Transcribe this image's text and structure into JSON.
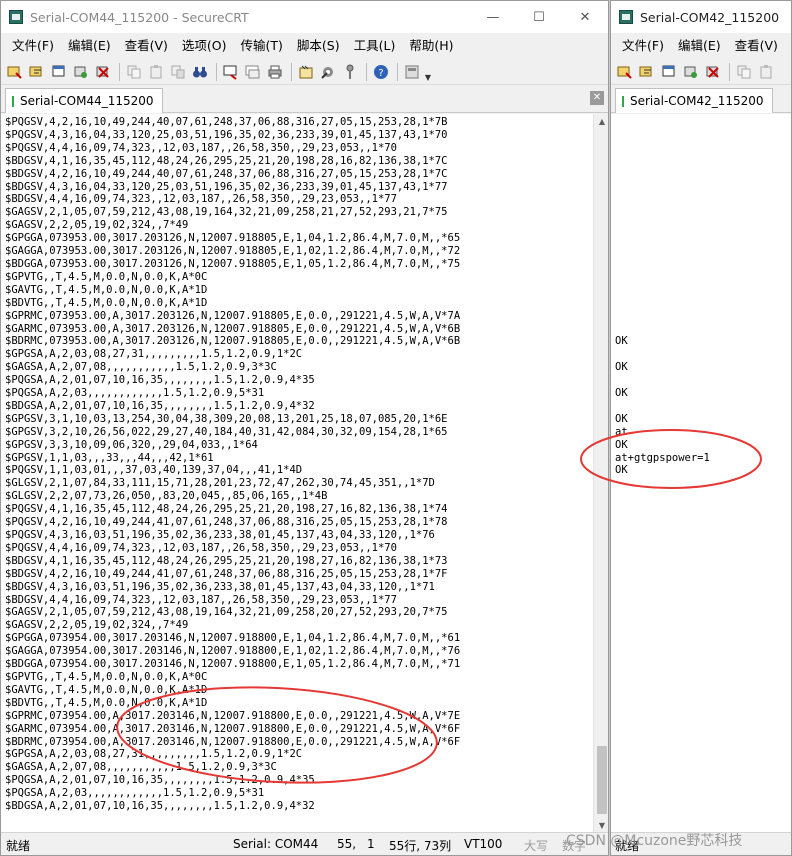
{
  "left": {
    "title": "Serial-COM44_115200 - SecureCRT",
    "tab_label": "Serial-COM44_115200",
    "menu": [
      "文件(F)",
      "编辑(E)",
      "查看(V)",
      "选项(O)",
      "传输(T)",
      "脚本(S)",
      "工具(L)",
      "帮助(H)"
    ],
    "terminal_lines": [
      "$PQGSV,4,2,16,10,49,244,40,07,61,248,37,06,88,316,27,05,15,253,28,1*7B",
      "$PQGSV,4,3,16,04,33,120,25,03,51,196,35,02,36,233,39,01,45,137,43,1*70",
      "$PQGSV,4,4,16,09,74,323,,12,03,187,,26,58,350,,29,23,053,,1*70",
      "$BDGSV,4,1,16,35,45,112,48,24,26,295,25,21,20,198,28,16,82,136,38,1*7C",
      "$BDGSV,4,2,16,10,49,244,40,07,61,248,37,06,88,316,27,05,15,253,28,1*7C",
      "$BDGSV,4,3,16,04,33,120,25,03,51,196,35,02,36,233,39,01,45,137,43,1*77",
      "$BDGSV,4,4,16,09,74,323,,12,03,187,,26,58,350,,29,23,053,,1*77",
      "$GAGSV,2,1,05,07,59,212,43,08,19,164,32,21,09,258,21,27,52,293,21,7*75",
      "$GAGSV,2,2,05,19,02,324,,7*49",
      "$GPGGA,073953.00,3017.203126,N,12007.918805,E,1,04,1.2,86.4,M,7.0,M,,*65",
      "$GAGGA,073953.00,3017.203126,N,12007.918805,E,1,02,1.2,86.4,M,7.0,M,,*72",
      "$BDGGA,073953.00,3017.203126,N,12007.918805,E,1,05,1.2,86.4,M,7.0,M,,*75",
      "$GPVTG,,T,4.5,M,0.0,N,0.0,K,A*0C",
      "$GAVTG,,T,4.5,M,0.0,N,0.0,K,A*1D",
      "$BDVTG,,T,4.5,M,0.0,N,0.0,K,A*1D",
      "$GPRMC,073953.00,A,3017.203126,N,12007.918805,E,0.0,,291221,4.5,W,A,V*7A",
      "$GARMC,073953.00,A,3017.203126,N,12007.918805,E,0.0,,291221,4.5,W,A,V*6B",
      "$BDRMC,073953.00,A,3017.203126,N,12007.918805,E,0.0,,291221,4.5,W,A,V*6B",
      "$GPGSA,A,2,03,08,27,31,,,,,,,,,1.5,1.2,0.9,1*2C",
      "$GAGSA,A,2,07,08,,,,,,,,,,,1.5,1.2,0.9,3*3C",
      "$PQGSA,A,2,01,07,10,16,35,,,,,,,,1.5,1.2,0.9,4*35",
      "$PQGSA,A,2,03,,,,,,,,,,,,1.5,1.2,0.9,5*31",
      "$BDGSA,A,2,01,07,10,16,35,,,,,,,,1.5,1.2,0.9,4*32",
      "$GPGSV,3,1,10,03,13,254,30,04,38,309,20,08,13,201,25,18,07,085,20,1*6E",
      "$GPGSV,3,2,10,26,56,022,29,27,40,184,40,31,42,084,30,32,09,154,28,1*65",
      "$GPGSV,3,3,10,09,06,320,,29,04,033,,1*64",
      "$GPGSV,1,1,03,,,33,,,44,,,42,1*61",
      "$PQGSV,1,1,03,01,,,37,03,40,139,37,04,,,41,1*4D",
      "$GLGSV,2,1,07,84,33,111,15,71,28,201,23,72,47,262,30,74,45,351,,1*7D",
      "$GLGSV,2,2,07,73,26,050,,83,20,045,,85,06,165,,1*4B",
      "$PQGSV,4,1,16,35,45,112,48,24,26,295,25,21,20,198,27,16,82,136,38,1*74",
      "$PQGSV,4,2,16,10,49,244,41,07,61,248,37,06,88,316,25,05,15,253,28,1*78",
      "$PQGSV,4,3,16,03,51,196,35,02,36,233,38,01,45,137,43,04,33,120,,1*76",
      "$PQGSV,4,4,16,09,74,323,,12,03,187,,26,58,350,,29,23,053,,1*70",
      "$BDGSV,4,1,16,35,45,112,48,24,26,295,25,21,20,198,27,16,82,136,38,1*73",
      "$BDGSV,4,2,16,10,49,244,41,07,61,248,37,06,88,316,25,05,15,253,28,1*7F",
      "$BDGSV,4,3,16,03,51,196,35,02,36,233,38,01,45,137,43,04,33,120,,1*71",
      "$BDGSV,4,4,16,09,74,323,,12,03,187,,26,58,350,,29,23,053,,1*77",
      "$GAGSV,2,1,05,07,59,212,43,08,19,164,32,21,09,258,20,27,52,293,20,7*75",
      "$GAGSV,2,2,05,19,02,324,,7*49",
      "$GPGGA,073954.00,3017.203146,N,12007.918800,E,1,04,1.2,86.4,M,7.0,M,,*61",
      "$GAGGA,073954.00,3017.203146,N,12007.918800,E,1,02,1.2,86.4,M,7.0,M,,*76",
      "$BDGGA,073954.00,3017.203146,N,12007.918800,E,1,05,1.2,86.4,M,7.0,M,,*71",
      "$GPVTG,,T,4.5,M,0.0,N,0.0,K,A*0C",
      "$GAVTG,,T,4.5,M,0.0,N,0.0,K,A*1D",
      "$BDVTG,,T,4.5,M,0.0,N,0.0,K,A*1D",
      "$GPRMC,073954.00,A,3017.203146,N,12007.918800,E,0.0,,291221,4.5,W,A,V*7E",
      "$GARMC,073954.00,A,3017.203146,N,12007.918800,E,0.0,,291221,4.5,W,A,V*6F",
      "$BDRMC,073954.00,A,3017.203146,N,12007.918800,E,0.0,,291221,4.5,W,A,V*6F",
      "$GPGSA,A,2,03,08,27,31,,,,,,,,,1.5,1.2,0.9,1*2C",
      "$GAGSA,A,2,07,08,,,,,,,,,,,1.5,1.2,0.9,3*3C",
      "$PQGSA,A,2,01,07,10,16,35,,,,,,,,1.5,1.2,0.9,4*35",
      "$PQGSA,A,2,03,,,,,,,,,,,,1.5,1.2,0.9,5*31",
      "$BDGSA,A,2,01,07,10,16,35,,,,,,,,1.5,1.2,0.9,4*32"
    ],
    "status": {
      "ready": "就绪",
      "connection": "Serial: COM44",
      "row": "55,",
      "col": "1",
      "cursor": "55行, 73列",
      "emulation": "VT100",
      "caps": "大写",
      "num": "数字"
    }
  },
  "right": {
    "title": "Serial-COM42_115200",
    "tab_label": "Serial-COM42_115200",
    "menu": [
      "文件(F)",
      "编辑(E)",
      "查看(V)"
    ],
    "terminal_lines": [
      "",
      "",
      "",
      "",
      "",
      "",
      "",
      "",
      "",
      "",
      "",
      "",
      "",
      "",
      "",
      "",
      "",
      "OK",
      "",
      "OK",
      "",
      "OK",
      "",
      "OK",
      "at",
      "OK",
      "at+gtgpspower=1",
      "OK"
    ],
    "status": {
      "ready": "就绪"
    }
  },
  "watermark": "CSDN @Mcuzone野芯科技",
  "annotation_color": "#e53935"
}
